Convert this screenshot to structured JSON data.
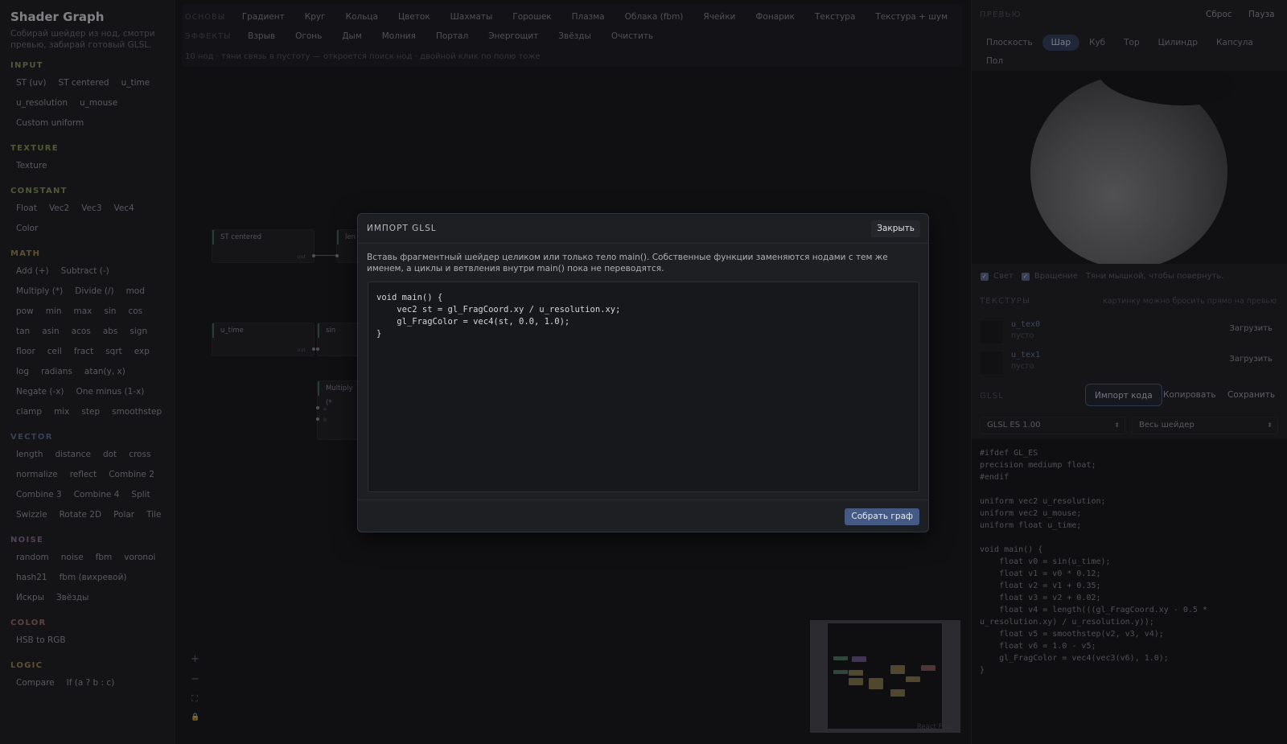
{
  "app": {
    "title": "Shader Graph",
    "subtitle": "Собирай шейдер из нод, смотри превью, забирай готовый GLSL."
  },
  "sidebar": {
    "sections": [
      {
        "title": "INPUT",
        "color": "#8a9a5b",
        "items": [
          "ST (uv)",
          "ST centered",
          "u_time",
          "u_resolution",
          "u_mouse",
          "Custom uniform"
        ]
      },
      {
        "title": "TEXTURE",
        "color": "#8a9a5b",
        "items": [
          "Texture"
        ]
      },
      {
        "title": "CONSTANT",
        "color": "#8a9a5b",
        "items": [
          "Float",
          "Vec2",
          "Vec3",
          "Vec4",
          "Color"
        ]
      },
      {
        "title": "MATH",
        "color": "#a58a4e",
        "items": [
          "Add (+)",
          "Subtract (-)",
          "Multiply (*)",
          "Divide (/)",
          "mod",
          "pow",
          "min",
          "max",
          "sin",
          "cos",
          "tan",
          "asin",
          "acos",
          "abs",
          "sign",
          "floor",
          "ceil",
          "fract",
          "sqrt",
          "exp",
          "log",
          "radians",
          "atan(y, x)",
          "Negate (-x)",
          "One minus (1-x)",
          "clamp",
          "mix",
          "step",
          "smoothstep"
        ]
      },
      {
        "title": "VECTOR",
        "color": "#5d6f93",
        "items": [
          "length",
          "distance",
          "dot",
          "cross",
          "normalize",
          "reflect",
          "Combine 2",
          "Combine 3",
          "Combine 4",
          "Split",
          "Swizzle",
          "Rotate 2D",
          "Polar",
          "Tile"
        ]
      },
      {
        "title": "NOISE",
        "color": "#8e6f9a",
        "items": [
          "random",
          "noise",
          "fbm",
          "voronoi",
          "hash21",
          "fbm (вихревой)",
          "Искры",
          "Звёзды"
        ]
      },
      {
        "title": "COLOR",
        "color": "#a56f6f",
        "items": [
          "HSB to RGB"
        ]
      },
      {
        "title": "LOGIC",
        "color": "#a58a4e",
        "items": [
          "Compare",
          "If (a ? b : c)"
        ]
      }
    ]
  },
  "toolbar": {
    "basics_label": "ОСНОВЫ",
    "basics": [
      "Градиент",
      "Круг",
      "Кольца",
      "Цветок",
      "Шахматы",
      "Горошек",
      "Плазма",
      "Облака (fbm)",
      "Ячейки",
      "Фонарик",
      "Текстура",
      "Текстура + шум"
    ],
    "effects_label": "ЭФФЕКТЫ",
    "effects": [
      "Взрыв",
      "Огонь",
      "Дым",
      "Молния",
      "Портал",
      "Энергощит",
      "Звёзды",
      "Очистить"
    ],
    "hint": "10 нод · тяни связь в пустоту — откроется поиск нод · двойной клик по полю тоже"
  },
  "nodes": {
    "st_centered": "ST centered",
    "len": "len",
    "u_time": "u_time",
    "sin": "sin",
    "multiply": "Multiply (*",
    "out": "out",
    "a": "a",
    "b": "b"
  },
  "canvas": {
    "zoom_in": "+",
    "zoom_out": "−",
    "fit": "⛶",
    "lock": "🔒",
    "attribution": "React Flow"
  },
  "preview": {
    "header": "ПРЕВЬЮ",
    "reset": "Сброс",
    "pause": "Пауза",
    "shapes": [
      "Плоскость",
      "Шар",
      "Куб",
      "Тор",
      "Цилиндр",
      "Капсула",
      "Пол"
    ],
    "active_shape": "Шар",
    "light_label": "Свет",
    "light_checked": true,
    "rotation_label": "Вращение",
    "rotation_checked": true,
    "drag_hint": "Тяни мышкой, чтобы повернуть."
  },
  "textures": {
    "header": "ТЕКСТУРЫ",
    "hint": "картинку можно бросить прямо на превью",
    "items": [
      {
        "name": "u_tex0",
        "status": "пусто",
        "action": "Загрузить"
      },
      {
        "name": "u_tex1",
        "status": "пусто",
        "action": "Загрузить"
      }
    ]
  },
  "glsl": {
    "header": "GLSL",
    "import_btn": "Импорт кода",
    "copy_btn": "Копировать",
    "save_btn": "Сохранить",
    "version": "GLSL ES 1.00",
    "scope": "Весь шейдер",
    "code": "#ifdef GL_ES\nprecision mediump float;\n#endif\n\nuniform vec2 u_resolution;\nuniform vec2 u_mouse;\nuniform float u_time;\n\nvoid main() {\n    float v0 = sin(u_time);\n    float v1 = v0 * 0.12;\n    float v2 = v1 + 0.35;\n    float v3 = v2 + 0.02;\n    float v4 = length(((gl_FragCoord.xy - 0.5 *\nu_resolution.xy) / u_resolution.y));\n    float v5 = smoothstep(v2, v3, v4);\n    float v6 = 1.0 - v5;\n    gl_FragColor = vec4(vec3(v6), 1.0);\n}"
  },
  "modal": {
    "title": "ИМПОРТ GLSL",
    "close": "Закрыть",
    "description": "Вставь фрагментный шейдер целиком или только тело main(). Собственные функции заменяются нодами с тем же именем, а циклы и ветвления внутри main() пока не переводятся.",
    "code": "void main() {\n    vec2 st = gl_FragCoord.xy / u_resolution.xy;\n    gl_FragColor = vec4(st, 0.0, 1.0);\n}",
    "submit": "Собрать граф"
  }
}
